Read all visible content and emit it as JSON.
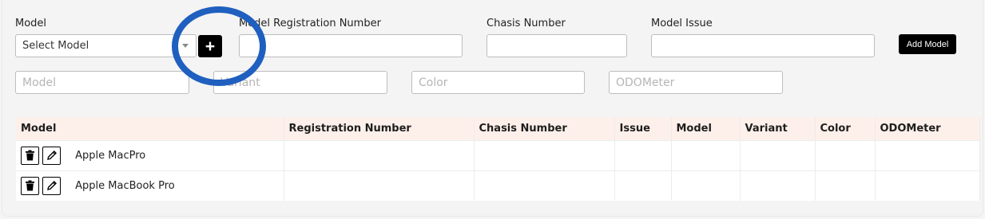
{
  "form": {
    "model": {
      "label": "Model",
      "selected": "Select Model"
    },
    "add_option_label": "+",
    "registration": {
      "label": "Model Registration Number",
      "value": ""
    },
    "chasis": {
      "label": "Chasis Number",
      "value": ""
    },
    "issue": {
      "label": "Model Issue",
      "value": ""
    },
    "add_button_label": "Add Model",
    "model_input": {
      "placeholder": "Model"
    },
    "variant_input": {
      "placeholder": "Variant"
    },
    "color_input": {
      "placeholder": "Color"
    },
    "odometer_input": {
      "placeholder": "ODOMeter"
    }
  },
  "table": {
    "headers": [
      "Model",
      "Registration Number",
      "Chasis Number",
      "Issue",
      "Model",
      "Variant",
      "Color",
      "ODOMeter"
    ],
    "rows": [
      {
        "model": "Apple MacPro"
      },
      {
        "model": "Apple MacBook Pro"
      }
    ]
  },
  "icons": {
    "delete": "trash-icon",
    "edit": "pencil-icon",
    "dropdown": "chevron-down-icon"
  },
  "colors": {
    "accent_button": "#000000",
    "table_header": "#fdf0ea",
    "annotation_circle": "#1f5fbf"
  }
}
